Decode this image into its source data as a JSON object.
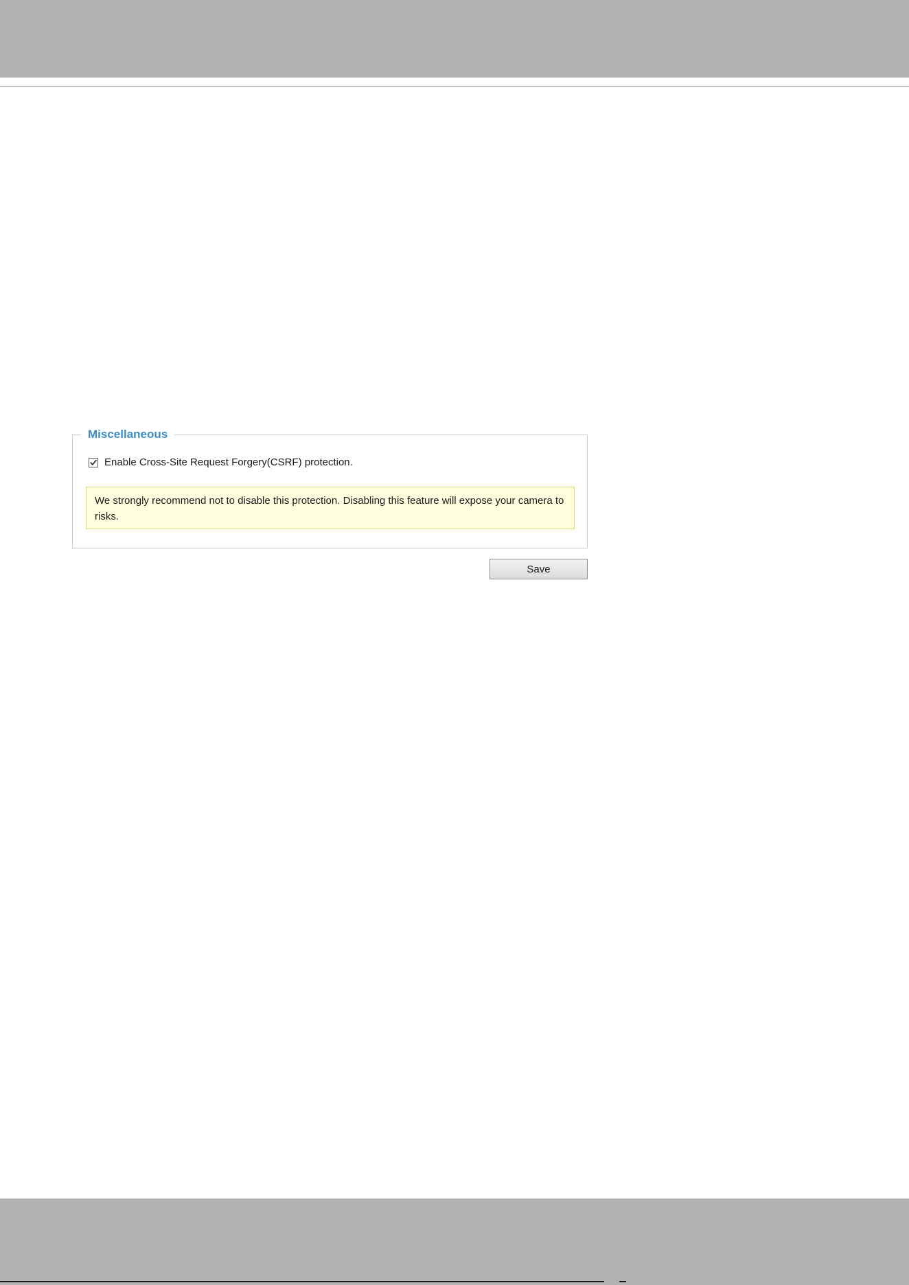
{
  "panel": {
    "legend": "Miscellaneous",
    "csrf": {
      "label": "Enable Cross-Site Request Forgery(CSRF) protection.",
      "checked": true
    },
    "warning": "We strongly recommend not to disable this protection. Disabling this feature will expose your camera to risks."
  },
  "actions": {
    "save_label": "Save"
  },
  "colors": {
    "legend_text": "#3a8cc8",
    "warning_background": "#ffffdf",
    "warning_border": "#e3d56a",
    "page_bar": "#b1b2b4"
  },
  "icons": {
    "checkbox_mark": "checkmark-icon"
  }
}
